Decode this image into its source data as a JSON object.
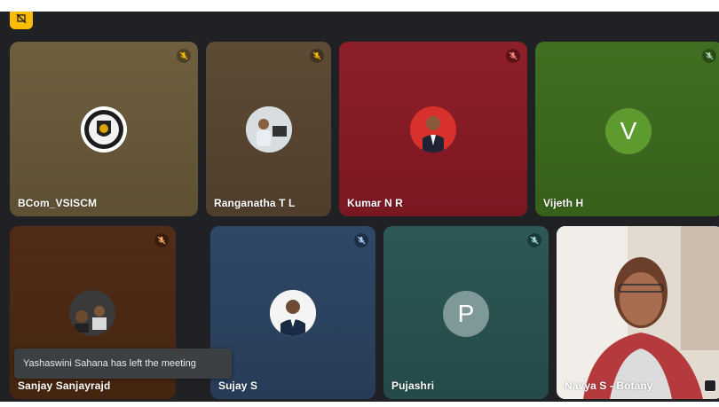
{
  "colors": {
    "stage": "#202124",
    "badge": "#fbbc04",
    "toast_bg": "#3c4043"
  },
  "top_badge": {
    "icon": "presentation-off-icon"
  },
  "participants": [
    {
      "name": "BCom_VSISCM",
      "avatar": "college-logo",
      "muted": true,
      "bg": "#6b5b3a"
    },
    {
      "name": "Ranganatha T L",
      "avatar": "photo",
      "muted": true,
      "bg": "#5a4733"
    },
    {
      "name": "Kumar N R",
      "avatar": "photo",
      "muted": true,
      "bg": "#8b1c26"
    },
    {
      "name": "Vijeth H",
      "avatar_letter": "V",
      "muted": true,
      "bg": "#3d6b1e"
    },
    {
      "name": "Sanjay Sanjayrajd",
      "avatar": "photo",
      "muted": true,
      "bg": "#4d2a16"
    },
    {
      "name": "Sujay S",
      "avatar": "photo",
      "muted": true,
      "bg": "#2d4563"
    },
    {
      "name": "Pujashri",
      "avatar_letter": "P",
      "muted": true,
      "bg": "#2a5554"
    },
    {
      "name": "Navya S - Botany",
      "avatar": "video",
      "muted": false,
      "bg": "#c9b9a6"
    }
  ],
  "toast": {
    "message": "Yashaswini Sahana has left the meeting"
  }
}
